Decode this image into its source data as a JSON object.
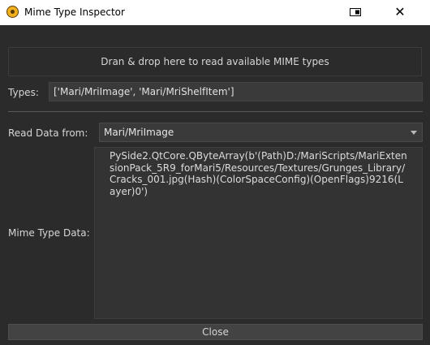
{
  "window": {
    "title": "Mime Type Inspector",
    "icons": [
      "mari-app-icon",
      "restore-window-icon",
      "close-icon"
    ],
    "close_glyph": "✕"
  },
  "drop_zone": {
    "text": "Dran & drop here to read available MIME types"
  },
  "types": {
    "label": "Types:",
    "value": "['Mari/MriImage', 'Mari/MriShelfItem']"
  },
  "read_data": {
    "label": "Read Data from:",
    "selected": "Mari/MriImage"
  },
  "mime_data": {
    "label": "Mime Type Data:",
    "value": "PySide2.QtCore.QByteArray(b'(Path)D:/MariScripts/MariExtensionPack_5R9_forMari5/Resources/Textures/Grunges_Library/Cracks_001.jpg(Hash)(ColorSpaceConfig)(OpenFlags)9216(Layer)0')"
  },
  "buttons": {
    "close_label": "Close"
  },
  "colors": {
    "background": "#2b2b2b",
    "field": "#3a3a3a",
    "text": "#d6d6d6",
    "titlebar": "#ffffff"
  }
}
